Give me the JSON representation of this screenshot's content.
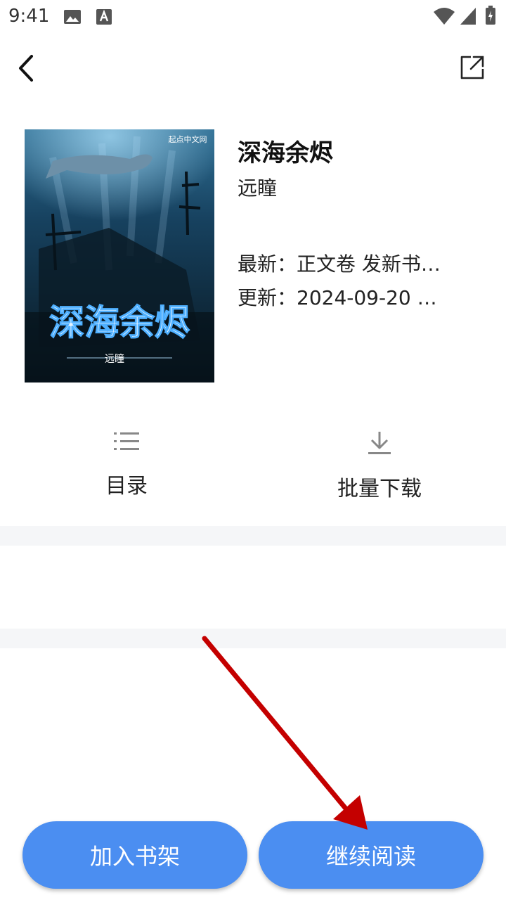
{
  "status_bar": {
    "time": "9:41",
    "icons": [
      "image-icon",
      "a-text-icon",
      "wifi-icon",
      "signal-icon",
      "battery-icon"
    ]
  },
  "header": {
    "icons": [
      "back-arrow-icon",
      "share-icon"
    ]
  },
  "book": {
    "title": "深海余烬",
    "author": "远瞳",
    "latest": "最新：正文卷 发新书…",
    "updated": "更新：2024-09-20 …",
    "cover": {
      "publisher": "起点中文网",
      "title": "深海余烬",
      "author": "远瞳"
    }
  },
  "actions": {
    "toc_label": "目录",
    "download_label": "批量下载",
    "toc_icon": "list-icon",
    "download_icon": "download-icon"
  },
  "buttons": {
    "add_shelf": "加入书架",
    "continue_read": "继续阅读"
  },
  "colors": {
    "accent": "#4b8ef1",
    "annotation_arrow": "#c40000",
    "divider": "#f5f6f8"
  }
}
